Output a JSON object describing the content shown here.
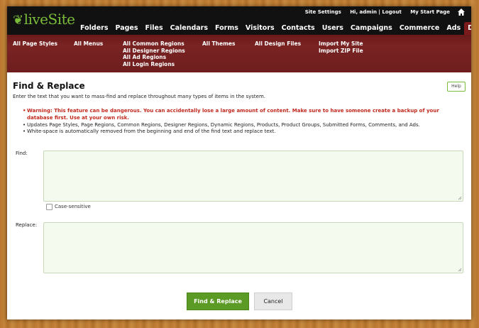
{
  "app": {
    "logo_text": "liveSite"
  },
  "utility": {
    "site_settings": "Site Settings",
    "greeting": "Hi, admin | Logout",
    "start_page": "My Start Page"
  },
  "nav": [
    {
      "label": "Folders",
      "active": false
    },
    {
      "label": "Pages",
      "active": false
    },
    {
      "label": "Files",
      "active": false
    },
    {
      "label": "Calendars",
      "active": false
    },
    {
      "label": "Forms",
      "active": false
    },
    {
      "label": "Visitors",
      "active": false
    },
    {
      "label": "Contacts",
      "active": false
    },
    {
      "label": "Users",
      "active": false
    },
    {
      "label": "Campaigns",
      "active": false
    },
    {
      "label": "Commerce",
      "active": false
    },
    {
      "label": "Ads",
      "active": false
    },
    {
      "label": "Design",
      "active": true
    }
  ],
  "subnav": {
    "page_styles": "All Page Styles",
    "menus": "All Menus",
    "regions": [
      "All Common Regions",
      "All Designer Regions",
      "All Ad Regions",
      "All Login Regions"
    ],
    "themes": "All Themes",
    "design_files": "All Design Files",
    "import": [
      "Import My Site",
      "Import ZIP File"
    ]
  },
  "page": {
    "title": "Find & Replace",
    "help_label": "Help",
    "intro": "Enter the text that you want to mass-find and replace throughout many types of items in the system.",
    "warning_line1": "Warning: This feature can be dangerous. You can accidentally lose a large amount of content. Make sure to have someone create a backup of your",
    "warning_line2": "database first. Use at your own risk.",
    "note_updates": "Updates Page Styles, Page Regions, Common Regions, Designer Regions, Dynamic Regions, Products, Product Groups, Submitted Forms, Comments, and Ads.",
    "note_whitespace": "White-space is automatically removed from the beginning and end of the find text and replace text."
  },
  "form": {
    "find_label": "Find:",
    "find_value": "",
    "case_label": "Case-sensitive",
    "case_checked": false,
    "replace_label": "Replace:",
    "replace_value": "",
    "submit_label": "Find & Replace",
    "cancel_label": "Cancel"
  },
  "colors": {
    "accent_green": "#5b9a24",
    "header_red": "#7a1a1a",
    "warning_red": "#c0281e"
  }
}
